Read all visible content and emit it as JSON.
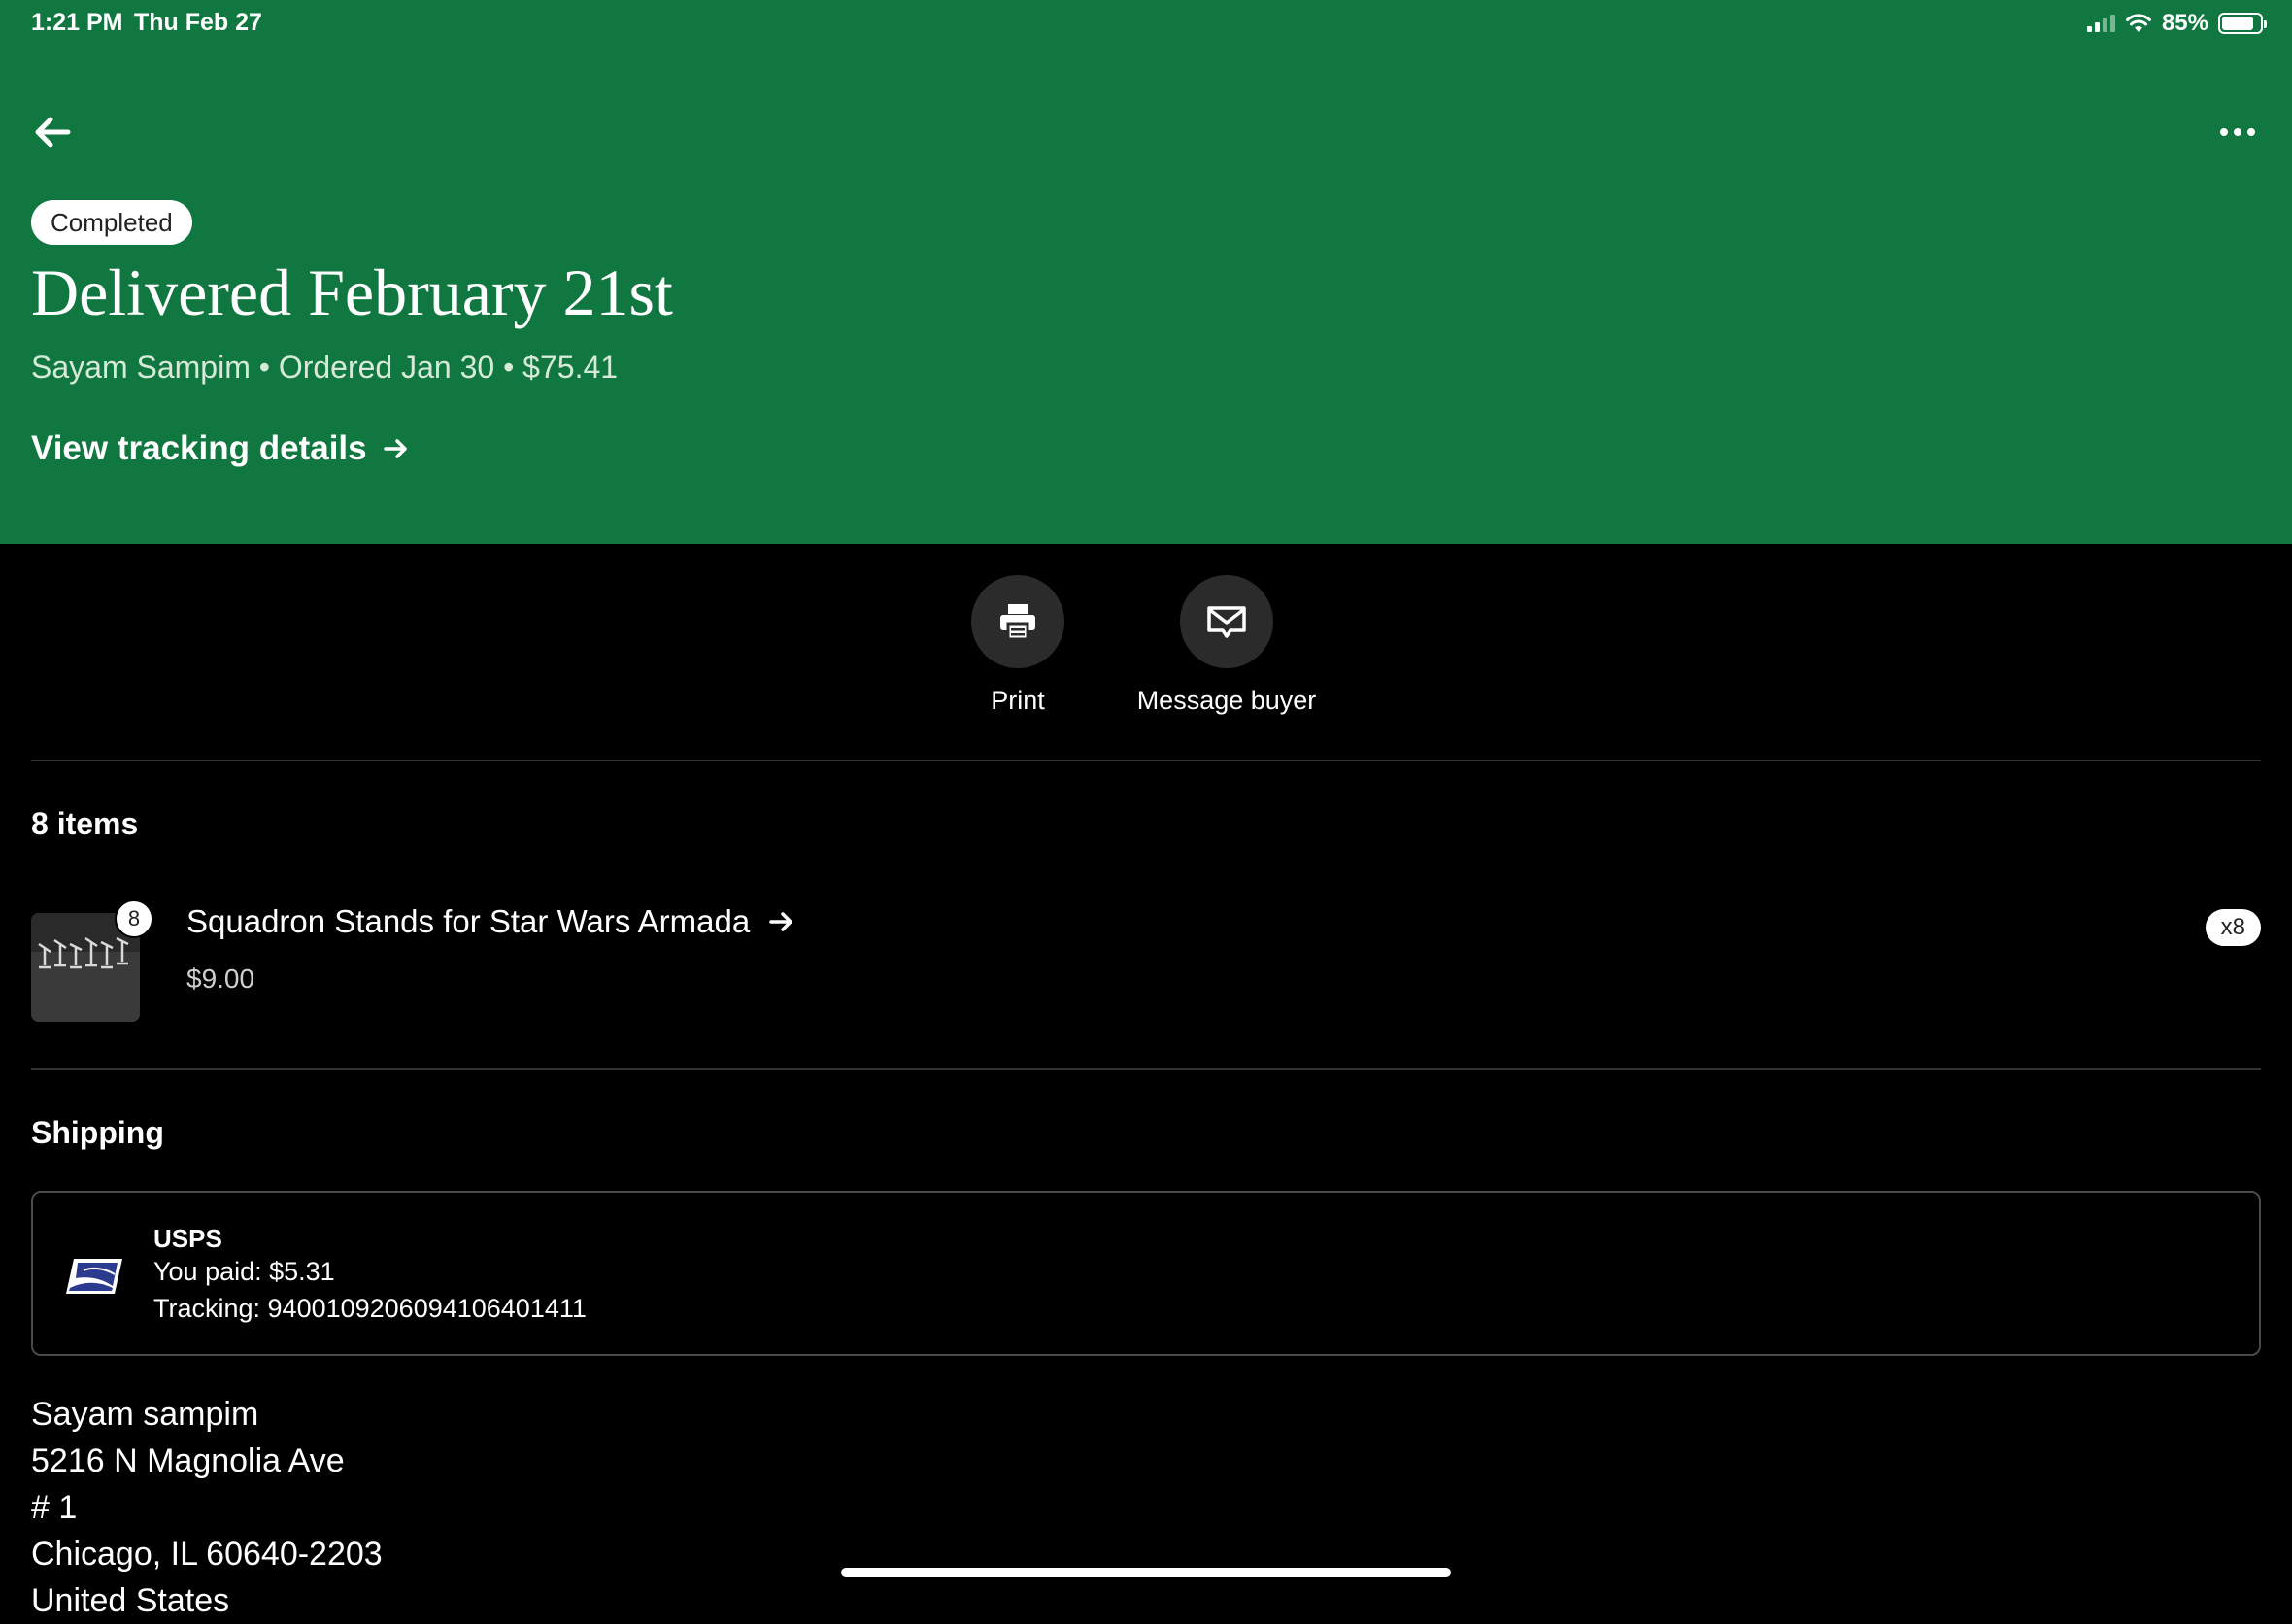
{
  "status_bar": {
    "time": "1:21 PM",
    "date": "Thu Feb 27",
    "battery": "85%",
    "battery_level": 0.85
  },
  "header": {
    "status_label": "Completed",
    "title": "Delivered February 21st",
    "meta": "Sayam Sampim • Ordered Jan 30 • $75.41",
    "tracking_link": "View tracking details",
    "background_color": "#117740"
  },
  "actions": {
    "print_label": "Print",
    "message_label": "Message buyer"
  },
  "items": {
    "heading": "8 items",
    "list": [
      {
        "title": "Squadron Stands for Star Wars Armada",
        "price": "$9.00",
        "badge": "8",
        "quantity": "x8"
      }
    ]
  },
  "shipping": {
    "heading": "Shipping",
    "carrier": "USPS",
    "paid": "You paid: $5.31",
    "tracking": "Tracking: 9400109206094106401411"
  },
  "address": {
    "line1": "Sayam sampim",
    "line2": "5216 N Magnolia Ave",
    "line3": "# 1",
    "line4": "Chicago, IL 60640-2203",
    "line5": "United States"
  },
  "icons": {
    "back": "arrow-left-icon",
    "more": "more-horizontal-icon",
    "print": "printer-icon",
    "message": "envelope-icon",
    "carrier": "usps-eagle-icon"
  }
}
